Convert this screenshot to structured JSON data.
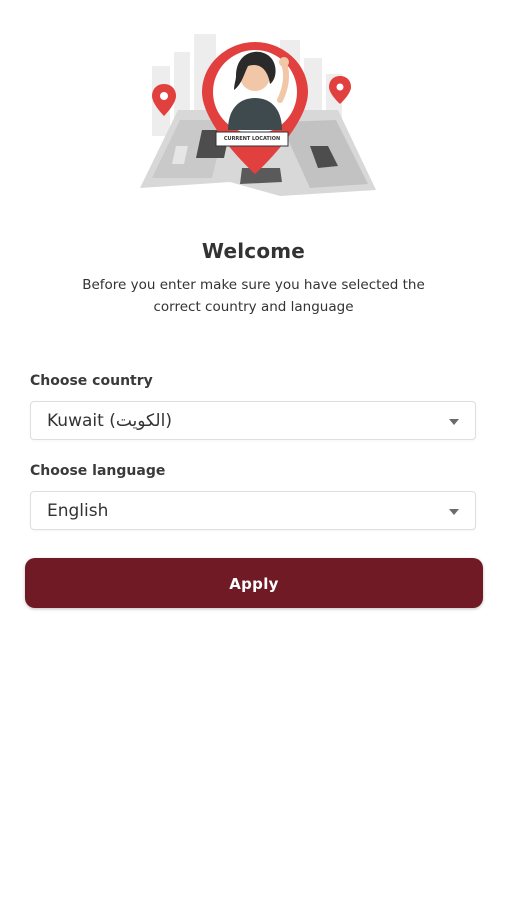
{
  "hero": {
    "badge_text": "CURRENT LOCATION",
    "pin_color": "#e2403f"
  },
  "welcome": {
    "title": "Welcome",
    "subtitle_line1": "Before you enter make sure you have selected the",
    "subtitle_line2": "correct country and language"
  },
  "country": {
    "label": "Choose country",
    "value": "Kuwait (الكويت)"
  },
  "language": {
    "label": "Choose language",
    "value": "English"
  },
  "apply": {
    "label": "Apply",
    "color": "#6f1a25"
  }
}
